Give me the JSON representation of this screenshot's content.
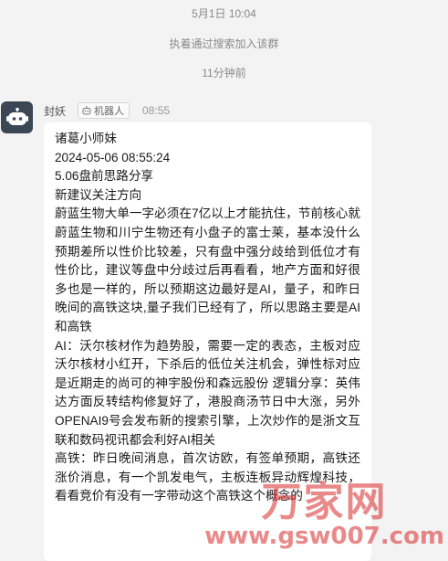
{
  "system": {
    "time_top": "5月1日 10:04",
    "join_notice": "执着通过搜索加入该群",
    "time_ago": "11分钟前"
  },
  "message": {
    "sender_name": "封妖",
    "bot_tag": "机器人",
    "time": "08:55",
    "lines": [
      "诸葛小师妹",
      "2024-05-06 08:55:24",
      "5.06盘前思路分享",
      "新建议关注方向"
    ],
    "paragraphs": [
      "蔚蓝生物大单一字必须在7亿以上才能抗住，节前核心就蔚蓝生物和川宁生物还有小盘子的富士莱，基本没什么预期差所以性价比较差，只有盘中强分歧给到低位才有性价比，建议等盘中分歧过后再看看，地产方面和好很多也是一样的，所以预期这边最好是AI，量子，和昨日晚间的高铁这块,量子我们已经有了，所以思路主要是AI和高铁",
      "AI：沃尔核材作为趋势股，需要一定的表态，主板对应沃尔核材小红开，下杀后的低位关注机会，弹性标对应是近期走的尚可的神宇股份和森远股份 逻辑分享：英伟达方面反转结构修复好了，港股商汤节日中大涨，另外OPENAI9号会发布新的搜索引擎，上次炒作的是浙文互联和数码视讯都会利好AI相关",
      "高铁：昨日晚间消息，首次访欧，有签单预期，高铁还涨价消息，有一个凯发电气，主板连板异动辉煌科技，看看竞价有没有一字带动这个高铁这个概念的"
    ]
  },
  "watermark": {
    "logo": "万家网",
    "url": "www.gsw007.com"
  },
  "icons": {
    "avatar": "robot-icon",
    "tag": "robot-icon"
  },
  "colors": {
    "background": "#f3f3f3",
    "avatar_bg": "#3c4755",
    "bubble_bg": "#ffffff",
    "watermark": "#d72828"
  }
}
